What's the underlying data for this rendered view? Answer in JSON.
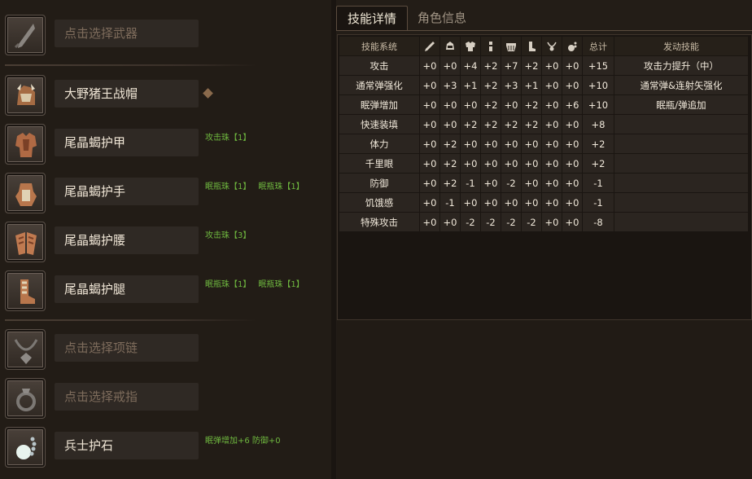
{
  "equipment": {
    "weapon": {
      "label": "点击选择武器",
      "icon": "weapon-icon",
      "empty": true
    },
    "helm": {
      "label": "大野猪王战帽",
      "icon": "helm-icon",
      "jewels": []
    },
    "chest": {
      "label": "尾晶蝎护甲",
      "icon": "chest-armor-icon",
      "jewels": [
        "攻击珠【1】"
      ]
    },
    "arms": {
      "label": "尾晶蝎护手",
      "icon": "gauntlet-icon",
      "jewels": [
        "眠瓶珠【1】",
        "眠瓶珠【1】"
      ]
    },
    "waist": {
      "label": "尾晶蝎护腰",
      "icon": "waist-armor-icon",
      "jewels": [
        "攻击珠【3】"
      ]
    },
    "legs": {
      "label": "尾晶蝎护腿",
      "icon": "leg-armor-icon",
      "jewels": [
        "眠瓶珠【1】",
        "眠瓶珠【1】"
      ]
    },
    "necklace": {
      "label": "点击选择项链",
      "icon": "necklace-icon",
      "empty": true
    },
    "ring": {
      "label": "点击选择戒指",
      "icon": "ring-icon",
      "empty": true
    },
    "talisman": {
      "label": "兵士护石",
      "icon": "talisman-icon",
      "jewels": [
        "眠弹增加+6 防御+0"
      ]
    }
  },
  "tabs": {
    "skill_details": "技能详情",
    "character_info": "角色信息",
    "active": "skill_details"
  },
  "skill_table": {
    "header": {
      "skill_system": "技能系统",
      "slot_icons": [
        "weapon-icon",
        "helm-icon",
        "chest-armor-icon",
        "gauntlet-icon",
        "waist-armor-icon",
        "leg-armor-icon",
        "talisman-icon",
        "necklace-icon"
      ],
      "total": "总计",
      "activated": "发动技能"
    },
    "rows": [
      {
        "skill": "攻击",
        "values": [
          "+0",
          "+0",
          "+4",
          "+2",
          "+7",
          "+2",
          "+0",
          "+0"
        ],
        "total": "+15",
        "activated": "攻击力提升（中）"
      },
      {
        "skill": "通常弹强化",
        "values": [
          "+0",
          "+3",
          "+1",
          "+2",
          "+3",
          "+1",
          "+0",
          "+0"
        ],
        "total": "+10",
        "activated": "通常弹&连射矢强化"
      },
      {
        "skill": "眠弹增加",
        "values": [
          "+0",
          "+0",
          "+0",
          "+2",
          "+0",
          "+2",
          "+0",
          "+6"
        ],
        "total": "+10",
        "activated": "眠瓶/弹追加"
      },
      {
        "skill": "快速装填",
        "values": [
          "+0",
          "+0",
          "+2",
          "+2",
          "+2",
          "+2",
          "+0",
          "+0"
        ],
        "total": "+8",
        "activated": ""
      },
      {
        "skill": "体力",
        "values": [
          "+0",
          "+2",
          "+0",
          "+0",
          "+0",
          "+0",
          "+0",
          "+0"
        ],
        "total": "+2",
        "activated": ""
      },
      {
        "skill": "千里眼",
        "values": [
          "+0",
          "+2",
          "+0",
          "+0",
          "+0",
          "+0",
          "+0",
          "+0"
        ],
        "total": "+2",
        "activated": ""
      },
      {
        "skill": "防御",
        "values": [
          "+0",
          "+2",
          "-1",
          "+0",
          "-2",
          "+0",
          "+0",
          "+0"
        ],
        "total": "-1",
        "activated": ""
      },
      {
        "skill": "饥饿感",
        "values": [
          "+0",
          "-1",
          "+0",
          "+0",
          "+0",
          "+0",
          "+0",
          "+0"
        ],
        "total": "-1",
        "activated": ""
      },
      {
        "skill": "特殊攻击",
        "values": [
          "+0",
          "+0",
          "-2",
          "-2",
          "-2",
          "-2",
          "+0",
          "+0"
        ],
        "total": "-8",
        "activated": ""
      }
    ]
  }
}
